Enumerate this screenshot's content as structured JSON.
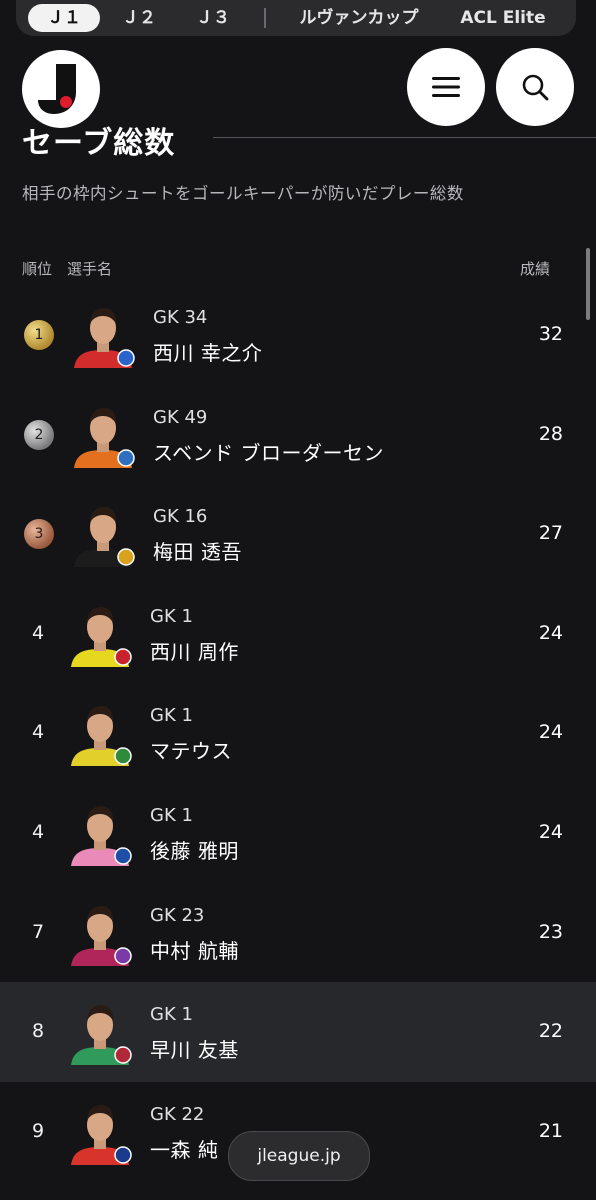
{
  "nav": {
    "tabs": [
      "Ｊ１",
      "Ｊ２",
      "Ｊ３",
      "ルヴァンカップ",
      "ACL Elite"
    ],
    "active_tab": "Ｊ１"
  },
  "header": {
    "logo_icon": "j-league-logo-icon",
    "menu_icon": "hamburger-menu-icon",
    "search_icon": "search-icon"
  },
  "page": {
    "title": "セーブ総数",
    "description": "相手の枠内シュートをゴールキーパーが防いだプレー総数"
  },
  "table": {
    "headers": {
      "rank": "順位",
      "player": "選手名",
      "result": "成績"
    },
    "rows": [
      {
        "rank": "1",
        "medal": "gold",
        "position": "GK 34",
        "name": "西川 幸之介",
        "score": "32",
        "kit": "#d22c2c",
        "badge": "#2a63c9"
      },
      {
        "rank": "2",
        "medal": "silver",
        "position": "GK 49",
        "name": "スベンド ブローダーセン",
        "score": "28",
        "kit": "#e2701e",
        "badge": "#2e6fbf"
      },
      {
        "rank": "3",
        "medal": "bronze",
        "position": "GK 16",
        "name": "梅田 透吾",
        "score": "27",
        "kit": "#1c1c1c",
        "badge": "#d9a21c"
      },
      {
        "rank": "4",
        "medal": "",
        "position": "GK 1",
        "name": "西川 周作",
        "score": "24",
        "kit": "#e6d81e",
        "badge": "#c8232c"
      },
      {
        "rank": "4",
        "medal": "",
        "position": "GK 1",
        "name": "マテウス",
        "score": "24",
        "kit": "#e2cf2a",
        "badge": "#2f8a3c"
      },
      {
        "rank": "4",
        "medal": "",
        "position": "GK 1",
        "name": "後藤 雅明",
        "score": "24",
        "kit": "#e98ab9",
        "badge": "#1d4fa8"
      },
      {
        "rank": "7",
        "medal": "",
        "position": "GK 23",
        "name": "中村 航輔",
        "score": "23",
        "kit": "#b0265a",
        "badge": "#7a3aa8"
      },
      {
        "rank": "8",
        "medal": "",
        "position": "GK 1",
        "name": "早川 友基",
        "score": "22",
        "kit": "#2f9a5a",
        "badge": "#b0283a",
        "highlight": true
      },
      {
        "rank": "9",
        "medal": "",
        "position": "GK 22",
        "name": "一森 純",
        "score": "21",
        "kit": "#d8342c",
        "badge": "#1a3c8c"
      }
    ]
  },
  "footer": {
    "site_label": "jleague.jp"
  }
}
